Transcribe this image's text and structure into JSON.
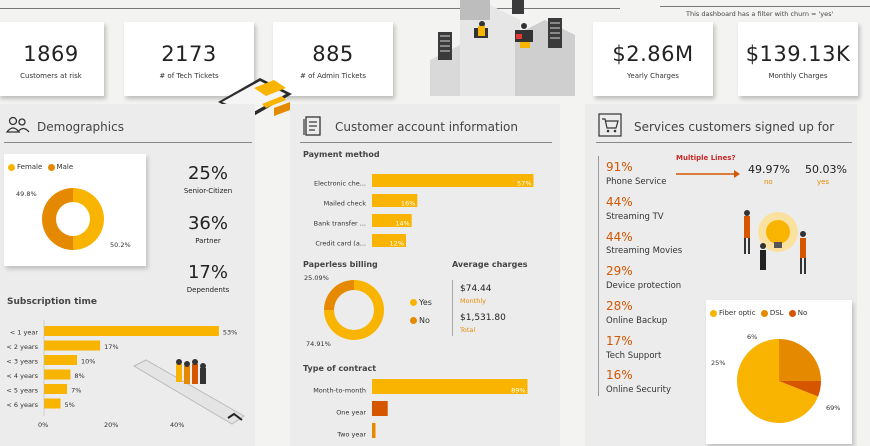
{
  "header": {
    "filter_note": "This dashboard has a filter with churn = 'yes'"
  },
  "kpis": [
    {
      "value": "1869",
      "label": "Customers at risk"
    },
    {
      "value": "2173",
      "label": "# of Tech Tickets"
    },
    {
      "value": "885",
      "label": "# of Admin Tickets"
    },
    {
      "value": "$2.86M",
      "label": "Yearly Charges"
    },
    {
      "value": "$139.13K",
      "label": "Monthly Charges"
    }
  ],
  "demographics": {
    "title": "Demographics",
    "legend": {
      "female": "Female",
      "male": "Male"
    },
    "female_pct_label": "49.8%",
    "male_pct_label": "50.2%",
    "stats": [
      {
        "value": "25%",
        "label": "Senior-Citizen"
      },
      {
        "value": "36%",
        "label": "Partner"
      },
      {
        "value": "17%",
        "label": "Dependents"
      }
    ]
  },
  "subscription": {
    "title": "Subscription time",
    "axis": [
      "0%",
      "20%",
      "40%"
    ]
  },
  "account": {
    "title": "Customer account information",
    "payment_title": "Payment method",
    "paperless_title": "Paperless billing",
    "paperless_yes_label": "25.09%",
    "paperless_no_label": "74.91%",
    "paperless_legend": {
      "yes": "Yes",
      "no": "No"
    },
    "avg_title": "Average charges",
    "avg_monthly_value": "$74.44",
    "avg_monthly_label": "Monthly",
    "avg_total_value": "$1,531.80",
    "avg_total_label": "Total",
    "contract_title": "Type of contract"
  },
  "services": {
    "title": "Services customers signed up for",
    "items": [
      {
        "pct": "91%",
        "name": "Phone Service"
      },
      {
        "pct": "44%",
        "name": "Streaming TV"
      },
      {
        "pct": "44%",
        "name": "Streaming Movies"
      },
      {
        "pct": "29%",
        "name": "Device protection"
      },
      {
        "pct": "28%",
        "name": "Online Backup"
      },
      {
        "pct": "17%",
        "name": "Tech Support"
      },
      {
        "pct": "16%",
        "name": "Online Security"
      }
    ],
    "multiple_lines_label": "Multiple Lines?",
    "multiple_no_value": "49.97%",
    "multiple_no_label": "no",
    "multiple_yes_value": "50.03%",
    "multiple_yes_label": "yes",
    "internet_legend": [
      "Fiber optic",
      "DSL",
      "No"
    ],
    "internet_labels": {
      "fiber": "69%",
      "dsl": "25%",
      "no": "6%"
    }
  },
  "colors": {
    "orange": "#f8b400",
    "dark_orange": "#e58a00",
    "red_orange": "#d65600",
    "panel": "#ececec"
  },
  "chart_data": [
    {
      "type": "pie",
      "title": "",
      "categories": [
        "Female",
        "Male"
      ],
      "values": [
        49.8,
        50.2
      ],
      "colors": [
        "#f8b400",
        "#e58a00"
      ]
    },
    {
      "type": "bar",
      "title": "Subscription time",
      "orientation": "horizontal",
      "categories": [
        "< 1 year",
        "< 2 years",
        "< 3 years",
        "< 4 years",
        "< 5 years",
        "< 6 years"
      ],
      "values": [
        53,
        17,
        10,
        8,
        7,
        5
      ],
      "value_labels": [
        "53%",
        "17%",
        "10%",
        "8%",
        "7%",
        "5%"
      ],
      "xlim": [
        0,
        60
      ],
      "xticks": [
        "0%",
        "20%",
        "40%"
      ]
    },
    {
      "type": "bar",
      "title": "Payment method",
      "orientation": "horizontal",
      "categories": [
        "Electronic che...",
        "Mailed check",
        "Bank transfer ...",
        "Credit card (a..."
      ],
      "values": [
        57,
        16,
        14,
        12
      ],
      "value_labels": [
        "57%",
        "16%",
        "14%",
        "12%"
      ],
      "xlim": [
        0,
        60
      ]
    },
    {
      "type": "pie",
      "title": "Paperless billing",
      "categories": [
        "Yes",
        "No"
      ],
      "values": [
        74.91,
        25.09
      ],
      "colors": [
        "#f8b400",
        "#e58a00"
      ]
    },
    {
      "type": "bar",
      "title": "Type of contract",
      "orientation": "horizontal",
      "categories": [
        "Month-to-month",
        "One year",
        "Two year"
      ],
      "values": [
        89,
        9,
        2
      ],
      "value_labels": [
        "89%",
        "",
        ""
      ],
      "xlim": [
        0,
        95
      ]
    },
    {
      "type": "pie",
      "title": "",
      "categories": [
        "Fiber optic",
        "DSL",
        "No"
      ],
      "values": [
        69,
        25,
        6
      ],
      "colors": [
        "#f8b400",
        "#e58a00",
        "#d65600"
      ]
    }
  ]
}
